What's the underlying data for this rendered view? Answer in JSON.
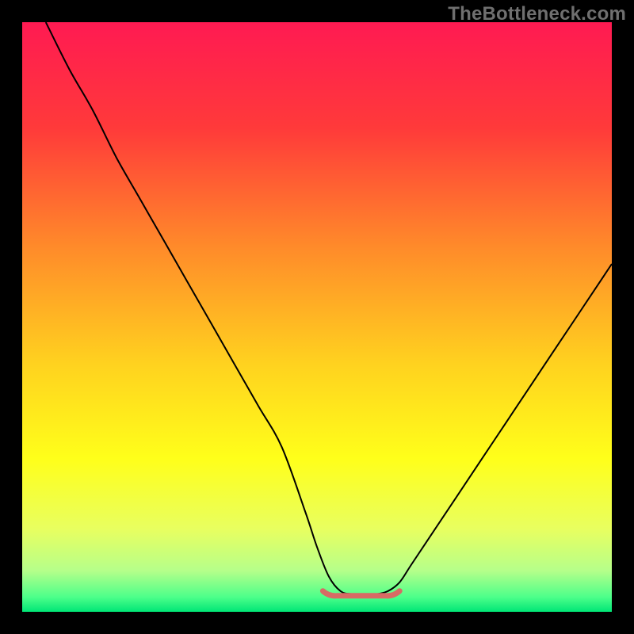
{
  "watermark": "TheBottleneck.com",
  "colors": {
    "frame": "#000000",
    "curve": "#000000",
    "marker": "#d86a64",
    "gradient_stops": [
      {
        "offset": 0.0,
        "color": "#ff1a52"
      },
      {
        "offset": 0.18,
        "color": "#ff3a3a"
      },
      {
        "offset": 0.38,
        "color": "#ff8a2a"
      },
      {
        "offset": 0.58,
        "color": "#ffd21f"
      },
      {
        "offset": 0.74,
        "color": "#ffff1a"
      },
      {
        "offset": 0.86,
        "color": "#e8ff60"
      },
      {
        "offset": 0.93,
        "color": "#b6ff8a"
      },
      {
        "offset": 0.975,
        "color": "#4dff8a"
      },
      {
        "offset": 1.0,
        "color": "#00e676"
      }
    ]
  },
  "chart_data": {
    "type": "line",
    "title": "",
    "xlabel": "",
    "ylabel": "",
    "xlim": [
      0,
      100
    ],
    "ylim": [
      0,
      100
    ],
    "grid": false,
    "series": [
      {
        "name": "bottleneck-curve",
        "x_percent": [
          4,
          8,
          12,
          16,
          20,
          24,
          28,
          32,
          36,
          40,
          44,
          48,
          50,
          52,
          54,
          56,
          58,
          60,
          62,
          64,
          66,
          70,
          74,
          78,
          82,
          86,
          90,
          94,
          98,
          100
        ],
        "y_percent": [
          100,
          92,
          85,
          77,
          70,
          63,
          56,
          49,
          42,
          35,
          28,
          17,
          11,
          6,
          3.5,
          3,
          3,
          3,
          3.5,
          5,
          8,
          14,
          20,
          26,
          32,
          38,
          44,
          50,
          56,
          59
        ]
      }
    ],
    "optimal_region": {
      "x_start_percent": 51,
      "x_end_percent": 64,
      "y_percent": 3
    }
  }
}
